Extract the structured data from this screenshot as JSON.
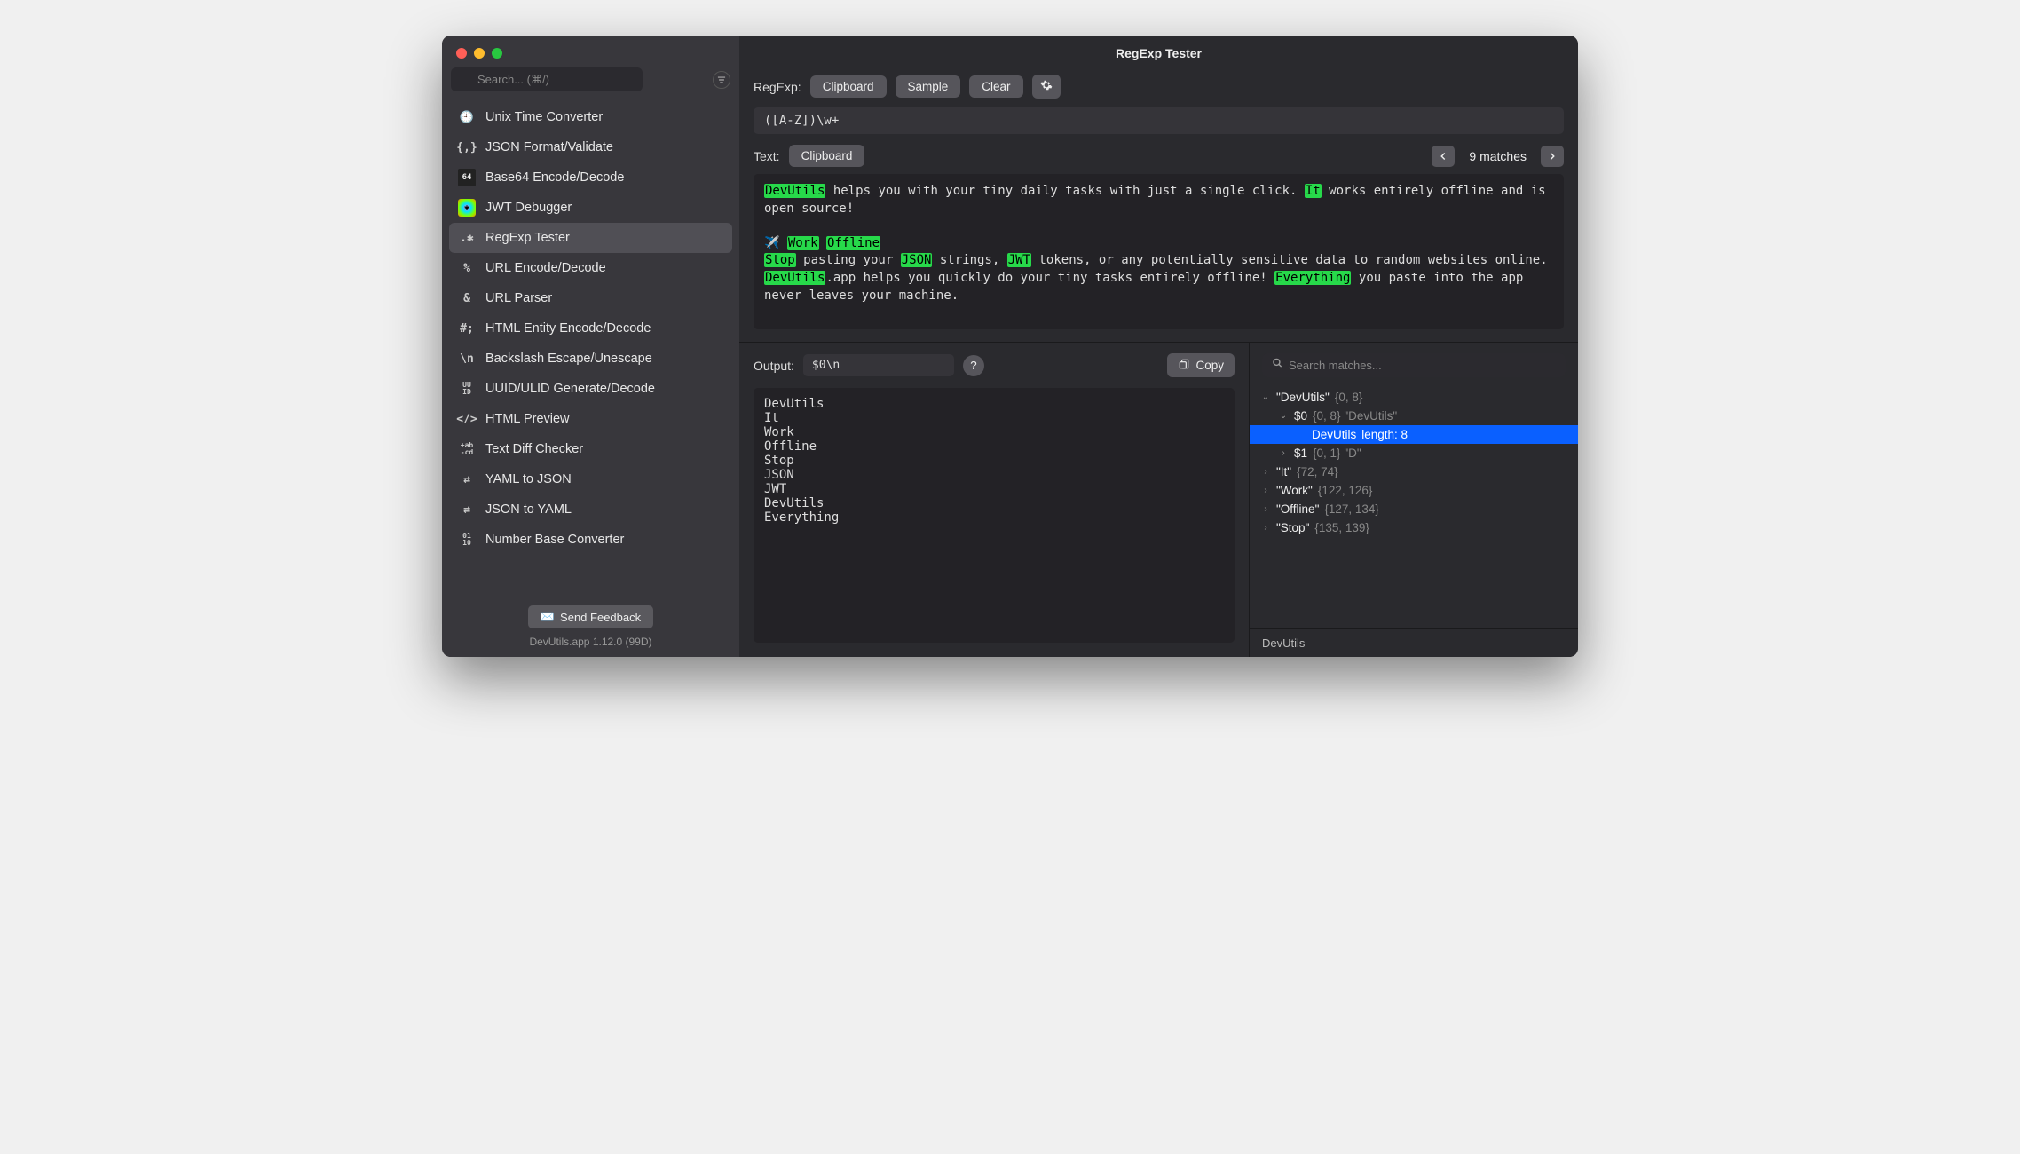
{
  "window_title": "RegExp Tester",
  "search_placeholder": "Search... (⌘/)",
  "sidebar": {
    "items": [
      {
        "icon": "clock-icon",
        "glyph": "🕘",
        "label": "Unix Time Converter"
      },
      {
        "icon": "json-icon",
        "glyph": "{,}",
        "label": "JSON Format/Validate"
      },
      {
        "icon": "base64-icon",
        "glyph": "64",
        "label": "Base64 Encode/Decode"
      },
      {
        "icon": "jwt-icon",
        "glyph": "✱",
        "label": "JWT Debugger"
      },
      {
        "icon": "regex-icon",
        "glyph": ".✱",
        "label": "RegExp Tester"
      },
      {
        "icon": "url-encode-icon",
        "glyph": "%",
        "label": "URL Encode/Decode"
      },
      {
        "icon": "url-parser-icon",
        "glyph": "&",
        "label": "URL Parser"
      },
      {
        "icon": "html-entity-icon",
        "glyph": "#;",
        "label": "HTML Entity Encode/Decode"
      },
      {
        "icon": "backslash-icon",
        "glyph": "\\n",
        "label": "Backslash Escape/Unescape"
      },
      {
        "icon": "uuid-icon",
        "glyph": "UU\nID",
        "label": "UUID/ULID Generate/Decode"
      },
      {
        "icon": "html-preview-icon",
        "glyph": "</>",
        "label": "HTML Preview"
      },
      {
        "icon": "diff-icon",
        "glyph": "+ab\n-cd",
        "label": "Text Diff Checker"
      },
      {
        "icon": "yaml-json-icon",
        "glyph": "⇄",
        "label": "YAML to JSON"
      },
      {
        "icon": "json-yaml-icon",
        "glyph": "⇄",
        "label": "JSON to YAML"
      },
      {
        "icon": "number-base-icon",
        "glyph": "01\n10",
        "label": "Number Base Converter"
      }
    ],
    "selected_index": 4,
    "feedback_label": "Send Feedback",
    "version_label": "DevUtils.app 1.12.0 (99D)"
  },
  "regex": {
    "label": "RegExp:",
    "clipboard_btn": "Clipboard",
    "sample_btn": "Sample",
    "clear_btn": "Clear",
    "settings_btn": "⚙",
    "pattern": "([A-Z])\\w+"
  },
  "text": {
    "label": "Text:",
    "clipboard_btn": "Clipboard",
    "match_count_label": "9 matches",
    "segments": [
      {
        "t": "DevUtils",
        "hl": true
      },
      {
        "t": " helps you with your tiny daily tasks with just a single click. ",
        "hl": false
      },
      {
        "t": "It",
        "hl": true
      },
      {
        "t": " works entirely offline and is open source!\n\n✈️ ",
        "hl": false
      },
      {
        "t": "Work",
        "hl": true
      },
      {
        "t": " ",
        "hl": false
      },
      {
        "t": "Offline",
        "hl": true
      },
      {
        "t": "\n",
        "hl": false
      },
      {
        "t": "Stop",
        "hl": true
      },
      {
        "t": " pasting your ",
        "hl": false
      },
      {
        "t": "JSON",
        "hl": true
      },
      {
        "t": " strings, ",
        "hl": false
      },
      {
        "t": "JWT",
        "hl": true
      },
      {
        "t": " tokens, or any potentially sensitive data to random websites online. ",
        "hl": false
      },
      {
        "t": "DevUtils",
        "hl": true
      },
      {
        "t": ".app helps you quickly do your tiny tasks entirely offline! ",
        "hl": false
      },
      {
        "t": "Everything",
        "hl": true
      },
      {
        "t": " you paste into the app never leaves your machine.",
        "hl": false
      }
    ]
  },
  "output": {
    "label": "Output:",
    "format": "$0\\n",
    "help": "?",
    "copy_btn": "Copy",
    "body": "DevUtils\nIt\nWork\nOffline\nStop\nJSON\nJWT\nDevUtils\nEverything"
  },
  "matches": {
    "search_placeholder": "Search matches...",
    "tree": [
      {
        "indent": 0,
        "chev": "v",
        "label": "\"DevUtils\"",
        "meta": "{0, 8}"
      },
      {
        "indent": 1,
        "chev": "v",
        "label": "$0",
        "meta": "{0, 8} \"DevUtils\""
      },
      {
        "indent": 2,
        "chev": "",
        "label": "DevUtils",
        "meta": "length: 8",
        "selected": true
      },
      {
        "indent": 1,
        "chev": ">",
        "label": "$1",
        "meta": "{0, 1} \"D\""
      },
      {
        "indent": 0,
        "chev": ">",
        "label": "\"It\"",
        "meta": "{72, 74}"
      },
      {
        "indent": 0,
        "chev": ">",
        "label": "\"Work\"",
        "meta": "{122, 126}"
      },
      {
        "indent": 0,
        "chev": ">",
        "label": "\"Offline\"",
        "meta": "{127, 134}"
      },
      {
        "indent": 0,
        "chev": ">",
        "label": "\"Stop\"",
        "meta": "{135, 139}"
      }
    ],
    "footer": "DevUtils"
  }
}
